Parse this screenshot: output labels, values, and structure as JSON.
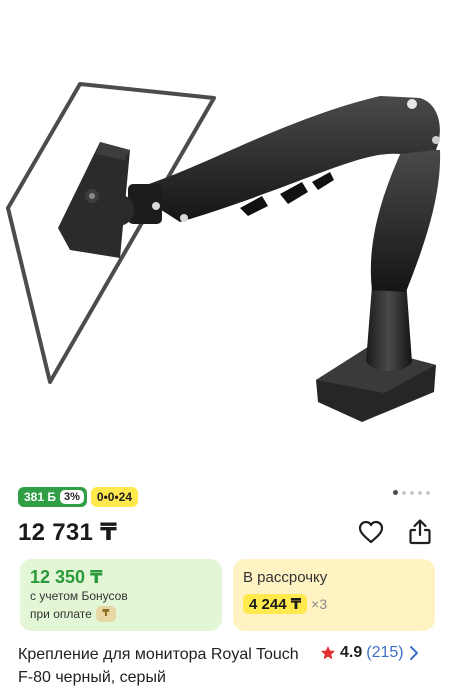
{
  "badges": {
    "bonus_amount": "381 Б",
    "bonus_percent": "3%",
    "installment": "0•0•24"
  },
  "product": {
    "price": "12 731 ₸",
    "title": "Крепление для монитора Royal Touch F-80 черный, серый"
  },
  "bonus_card": {
    "price": "12 350 ₸",
    "line1": "с учетом Бонусов",
    "line2": "при оплате"
  },
  "installment_card": {
    "title": "В рассрочку",
    "amount": "4 244 ₸",
    "times": "×3"
  },
  "rating": {
    "value": "4.9",
    "count": "(215)"
  },
  "colors": {
    "bonus_green": "#2f9e44",
    "installment_yellow": "#ffe94d",
    "rating_star": "#e03131",
    "link_blue": "#3d6fc7"
  },
  "icons": [
    "heart-icon",
    "share-icon",
    "star-icon",
    "chevron-right-icon",
    "kaspi-coin-icon"
  ]
}
